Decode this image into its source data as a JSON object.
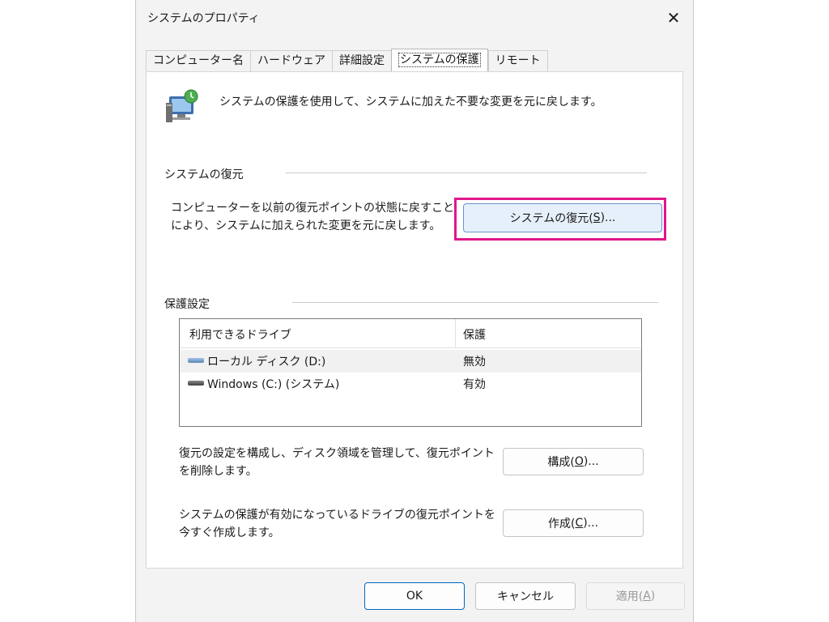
{
  "window": {
    "title": "システムのプロパティ",
    "close_glyph": "✕"
  },
  "tabs": [
    {
      "label": "コンピューター名",
      "active": false
    },
    {
      "label": "ハードウェア",
      "active": false
    },
    {
      "label": "詳細設定",
      "active": false
    },
    {
      "label": "システムの保護",
      "active": true
    },
    {
      "label": "リモート",
      "active": false
    }
  ],
  "intro": {
    "icon": "system-protection-icon",
    "text": "システムの保護を使用して、システムに加えた不要な変更を元に戻します。"
  },
  "restore": {
    "heading": "システムの復元",
    "description": "コンピューターを以前の復元ポイントの状態に戻すことにより、システムに加えられた変更を元に戻します。",
    "button_label_pre": "システムの復元(",
    "button_label_key": "S",
    "button_label_post": ")..."
  },
  "protection": {
    "heading": "保護設定",
    "columns": [
      "利用できるドライブ",
      "保護"
    ],
    "drives": [
      {
        "name": "ローカル ディスク (D:)",
        "status": "無効",
        "icon": "drive-icon",
        "selected": true
      },
      {
        "name": "Windows (C:) (システム)",
        "status": "有効",
        "icon": "system-drive-icon",
        "selected": false
      }
    ],
    "configure_desc": "復元の設定を構成し、ディスク領域を管理して、復元ポイントを削除します。",
    "configure_pre": "構成(",
    "configure_key": "O",
    "configure_post": ")...",
    "create_desc": "システムの保護が有効になっているドライブの復元ポイントを今すぐ作成します。",
    "create_pre": "作成(",
    "create_key": "C",
    "create_post": ")..."
  },
  "footer": {
    "ok": "OK",
    "cancel": "キャンセル",
    "apply_pre": "適用(",
    "apply_key": "A",
    "apply_post": ")"
  },
  "colors": {
    "highlight_frame": "#e0168c",
    "default_button_border": "#0067c0"
  }
}
